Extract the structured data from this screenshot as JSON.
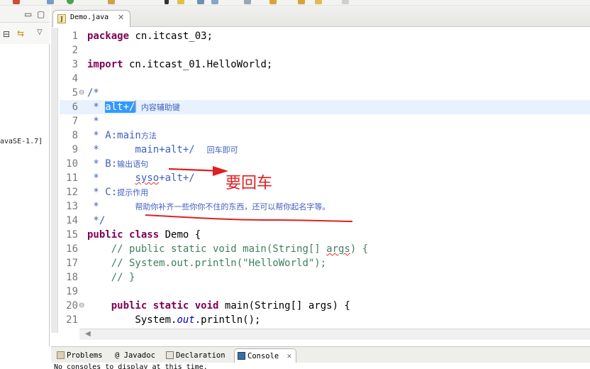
{
  "editor_tab": {
    "label": "Demo.java",
    "close": "✕"
  },
  "left_pane": {
    "jre_label": "avaSE-1.7]"
  },
  "code_lines": [
    {
      "n": "1",
      "html": "<span class='kw'>package</span> cn.itcast_03;"
    },
    {
      "n": "2",
      "html": ""
    },
    {
      "n": "3",
      "html": "<span class='kw'>import</span> cn.itcast_01.HelloWorld;"
    },
    {
      "n": "4",
      "html": ""
    },
    {
      "n": "5",
      "html": "<span class='cm'>/*</span>",
      "fold": "⊖"
    },
    {
      "n": "6",
      "html": "<span class='cm'> * <span class='sel'>alt+/</span>▏<span class='cn'>内容辅助键</span></span>",
      "hl": true
    },
    {
      "n": "7",
      "html": "<span class='cm'> *</span>"
    },
    {
      "n": "8",
      "html": "<span class='cm'> * A:main<span class='cn'>方法</span></span>"
    },
    {
      "n": "9",
      "html": "<span class='cm'> *      main+alt+/  <span class='cn'>回车即可</span></span>"
    },
    {
      "n": "10",
      "html": "<span class='cm'> * B:<span class='cn'>输出语句</span></span>"
    },
    {
      "n": "11",
      "html": "<span class='cm'> *      <span class='squig'>syso</span>+alt+/</span>"
    },
    {
      "n": "12",
      "html": "<span class='cm'> * C:<span class='cn'>提示作用</span></span>"
    },
    {
      "n": "13",
      "html": "<span class='cm'> *      <span class='cn'>帮助你补齐一些你你不住的东西，还可以帮你起名字等。</span></span>"
    },
    {
      "n": "14",
      "html": "<span class='cm'> */</span>"
    },
    {
      "n": "15",
      "html": "<span class='kw'>public</span> <span class='kw'>class</span> Demo {"
    },
    {
      "n": "16",
      "html": "    <span class='cm2'>// public static void main(String[] <span class='squig'>args</span>) {</span>"
    },
    {
      "n": "17",
      "html": "    <span class='cm2'>// System.out.println(\"HelloWorld\");</span>"
    },
    {
      "n": "18",
      "html": "    <span class='cm2'>// }</span>"
    },
    {
      "n": "19",
      "html": ""
    },
    {
      "n": "20",
      "html": "    <span class='kw'>public</span> <span class='kw'>static</span> <span class='kw'>void</span> main(String[] args) {",
      "fold": "⊖"
    },
    {
      "n": "21",
      "html": "        System.<span class='fld'>out</span>.println();"
    }
  ],
  "annotation": {
    "text": "要回车",
    "color": "#e02020"
  },
  "bottom_tabs": [
    {
      "label": "Problems",
      "icon": "problems-icon"
    },
    {
      "label": "@ Javadoc",
      "icon": "javadoc-icon"
    },
    {
      "label": "Declaration",
      "icon": "declaration-icon"
    },
    {
      "label": "Console",
      "icon": "console-icon",
      "active": true
    }
  ],
  "console_text": "No consoles to display at this time.",
  "colors": {
    "keyword": "#7f0055",
    "comment": "#3f5fbf",
    "line_comment": "#3f7f5f",
    "selection": "#3399ff",
    "current_line": "#e8f2fe"
  }
}
